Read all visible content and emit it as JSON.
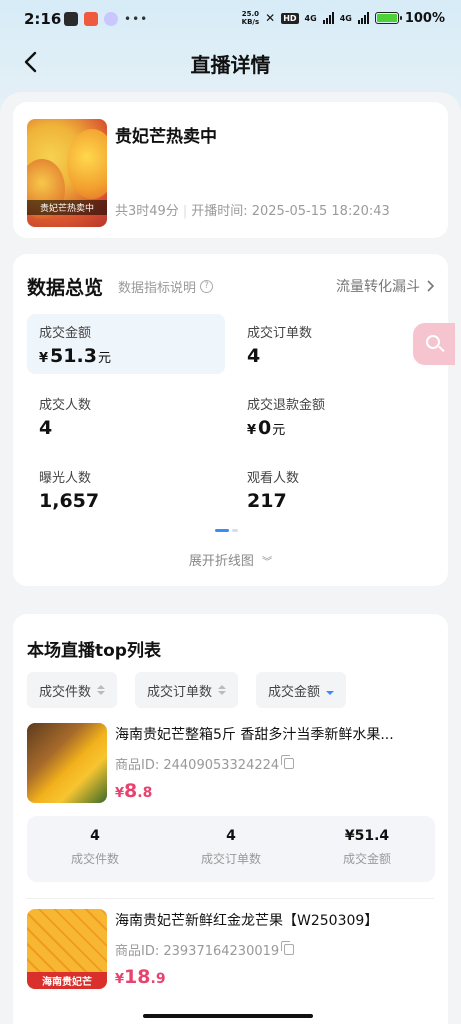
{
  "status_bar": {
    "time": "2:16",
    "dots": "•••",
    "speed_top": "25.0",
    "speed_bottom": "KB/s",
    "hd": "HD",
    "net1": "4G",
    "net2": "4G",
    "battery": "100%"
  },
  "nav": {
    "title": "直播详情"
  },
  "live": {
    "title": "贵妃芒热卖中",
    "thumb_caption": "贵妃芒热卖中",
    "duration": "共3时49分",
    "start_time": "开播时间: 2025-05-15 18:20:43"
  },
  "overview": {
    "title": "数据总览",
    "help_label": "数据指标说明",
    "funnel_link": "流量转化漏斗",
    "metrics": [
      {
        "label": "成交金额",
        "currency": "¥",
        "value": "51.3",
        "unit": "元"
      },
      {
        "label": "成交订单数",
        "value": "4"
      },
      {
        "label": "成交人数",
        "value": "4"
      },
      {
        "label": "成交退款金额",
        "currency": "¥",
        "value": "0",
        "unit": "元"
      },
      {
        "label": "曝光人数",
        "value": "1,657"
      },
      {
        "label": "观看人数",
        "value": "217"
      }
    ],
    "expand_label": "展开折线图"
  },
  "toplist": {
    "title": "本场直播top列表",
    "sort_buttons": [
      "成交件数",
      "成交订单数",
      "成交金额"
    ],
    "products": [
      {
        "name": "海南贵妃芒整箱5斤 香甜多汁当季新鲜水果...",
        "id": "商品ID: 24409053324224",
        "price_currency": "¥",
        "price_int": "8",
        "price_dec": ".8",
        "stats": [
          {
            "value": "4",
            "label": "成交件数"
          },
          {
            "value": "4",
            "label": "成交订单数"
          },
          {
            "value": "¥51.4",
            "label": "成交金额"
          }
        ]
      },
      {
        "name": "海南贵妃芒新鲜红金龙芒果【W250309】",
        "id": "商品ID: 23937164230019",
        "price_currency": "¥",
        "price_int": "18",
        "price_dec": ".9",
        "img_caption": "海南贵妃芒"
      }
    ]
  },
  "colors": {
    "accent_price": "#e8436e",
    "sort_active": "#3b8bff",
    "float_button": "#f6c4cf"
  }
}
